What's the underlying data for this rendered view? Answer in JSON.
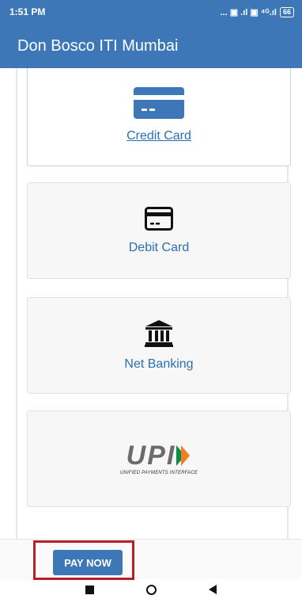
{
  "status_bar": {
    "time": "1:51 PM",
    "signal_text": "... ▣ .ıl ▣ ⁴ᴳ.ıl",
    "battery": "66"
  },
  "app_bar": {
    "title": "Don Bosco ITI Mumbai"
  },
  "payment_options": [
    {
      "label": "Credit Card",
      "icon": "credit-card-icon",
      "selected": true
    },
    {
      "label": "Debit Card",
      "icon": "debit-card-icon",
      "selected": false
    },
    {
      "label": "Net Banking",
      "icon": "bank-icon",
      "selected": false
    },
    {
      "label": "",
      "icon": "upi-logo",
      "logo_text": "UPI",
      "logo_subtext": "UNIFIED PAYMENTS INTERFACE",
      "selected": false
    }
  ],
  "pay_button": {
    "label": "PAY NOW"
  },
  "colors": {
    "primary": "#3d77b8",
    "highlight_border": "#b5202a",
    "upi_orange": "#f07f22",
    "upi_green": "#0a8f47"
  }
}
